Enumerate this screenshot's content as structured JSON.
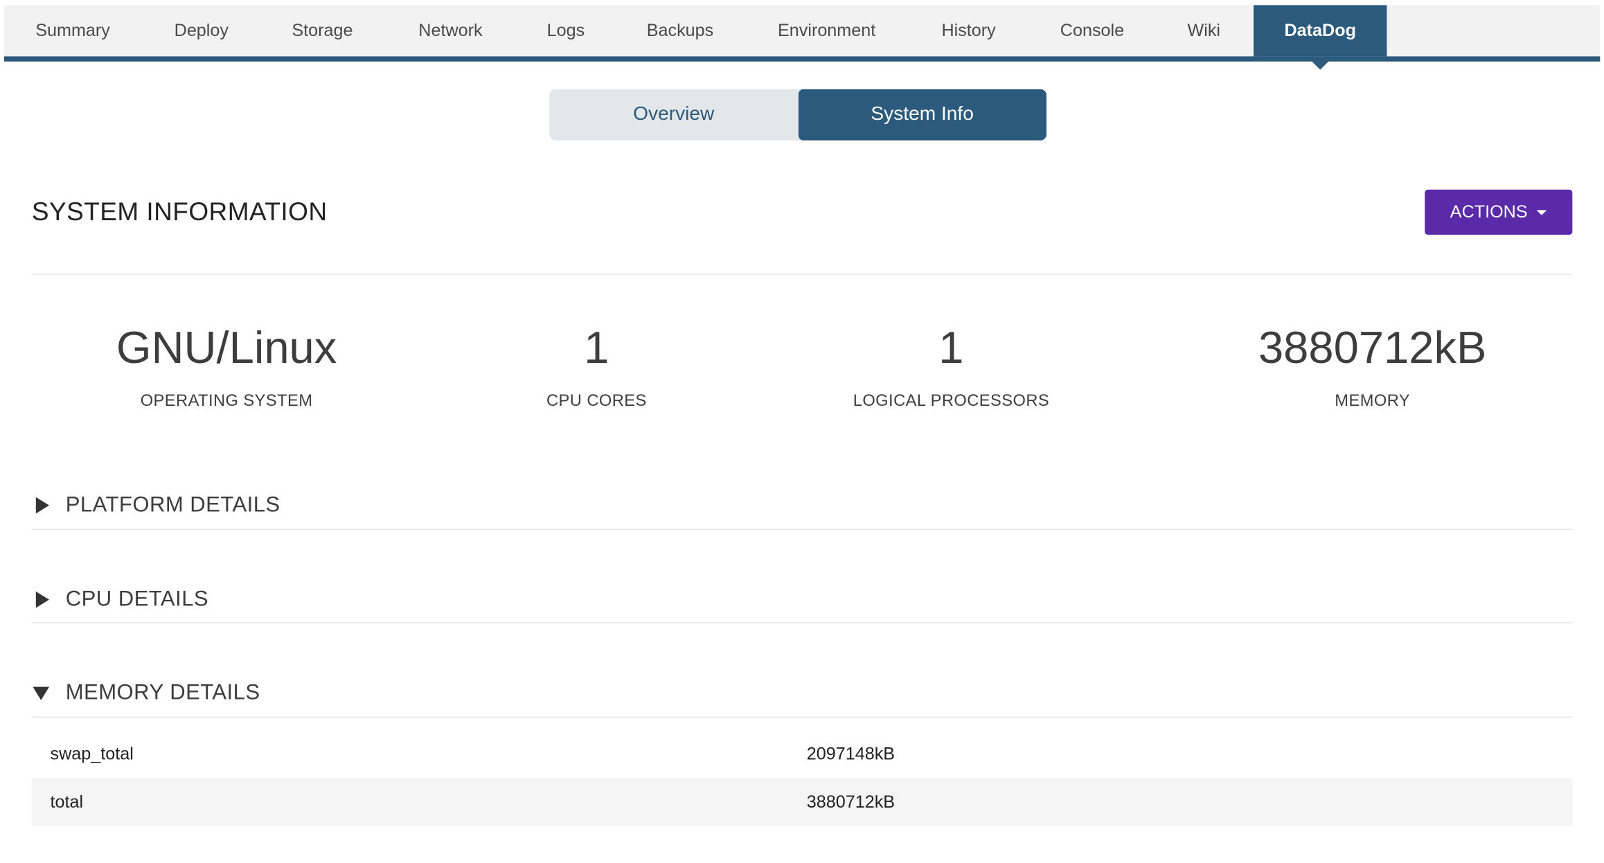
{
  "tabs": [
    {
      "label": "Summary",
      "active": false
    },
    {
      "label": "Deploy",
      "active": false
    },
    {
      "label": "Storage",
      "active": false
    },
    {
      "label": "Network",
      "active": false
    },
    {
      "label": "Logs",
      "active": false
    },
    {
      "label": "Backups",
      "active": false
    },
    {
      "label": "Environment",
      "active": false
    },
    {
      "label": "History",
      "active": false
    },
    {
      "label": "Console",
      "active": false
    },
    {
      "label": "Wiki",
      "active": false
    },
    {
      "label": "DataDog",
      "active": true
    }
  ],
  "subtabs": {
    "overview": "Overview",
    "system_info": "System Info",
    "active": "system_info"
  },
  "page": {
    "title": "SYSTEM INFORMATION",
    "actions_label": "ACTIONS"
  },
  "stats": {
    "os": {
      "value": "GNU/Linux",
      "label": "OPERATING SYSTEM"
    },
    "cpu_cores": {
      "value": "1",
      "label": "CPU CORES"
    },
    "logical_processors": {
      "value": "1",
      "label": "LOGICAL PROCESSORS"
    },
    "memory": {
      "value": "3880712kB",
      "label": "MEMORY"
    }
  },
  "sections": {
    "platform": {
      "title": "PLATFORM DETAILS",
      "expanded": false
    },
    "cpu": {
      "title": "CPU DETAILS",
      "expanded": false
    },
    "memory": {
      "title": "MEMORY DETAILS",
      "expanded": true
    }
  },
  "memory_details": {
    "rows": [
      {
        "key": "swap_total",
        "value": "2097148kB"
      },
      {
        "key": "total",
        "value": "3880712kB"
      }
    ]
  },
  "colors": {
    "primary": "#2b5a7d",
    "actions_button": "#5b2aa8",
    "tab_bar_bg": "#f2f2f2",
    "segmented_bg": "#e4e7ea"
  }
}
